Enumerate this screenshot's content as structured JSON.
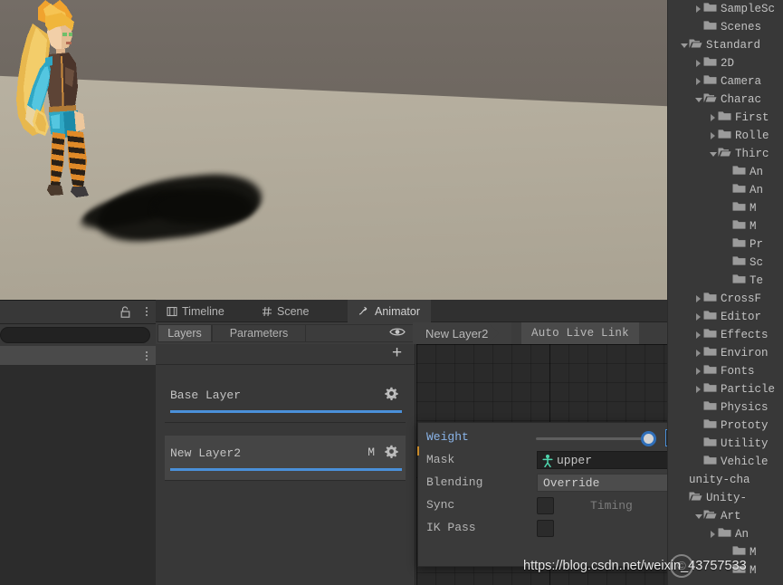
{
  "scene_view": {
    "name": "scene-viewport",
    "character_label": "character-model",
    "colors": {
      "wall": "#6d6660",
      "ground": "#aaa393",
      "shadow": "#0b0b08"
    }
  },
  "left_panel": {
    "lock_icon": "lock-icon",
    "menu_icon": "kebab-menu-icon",
    "search_placeholder": ""
  },
  "animator": {
    "tabs": [
      {
        "label": "Timeline",
        "icon": "timeline-icon",
        "active": false
      },
      {
        "label": "Scene",
        "icon": "grid-icon",
        "active": false
      },
      {
        "label": "Animator",
        "icon": "animator-icon",
        "active": true
      }
    ],
    "lock_icon": "lock-icon",
    "menu_icon": "kebab-menu-icon",
    "toolbar": {
      "layers_tab": "Layers",
      "parameters_tab": "Parameters",
      "eye_icon": "eye-icon",
      "breadcrumb": "New Layer2",
      "auto_live_link": "Auto Live Link"
    },
    "add_layer_icon": "plus-icon",
    "layers": [
      {
        "name": "Base Layer",
        "mask_flag": "",
        "gear_icon": "gear-icon",
        "selected": false
      },
      {
        "name": "New Layer2",
        "mask_flag": "M",
        "gear_icon": "gear-icon",
        "selected": true
      }
    ]
  },
  "layer_settings": {
    "weight": {
      "label": "Weight",
      "value": "1",
      "slider_min": 0,
      "slider_max": 1,
      "slider_pos": 1
    },
    "mask": {
      "label": "Mask",
      "value": "upper",
      "icon": "avatar-mask-icon",
      "picker_icon": "object-picker-icon"
    },
    "blending": {
      "label": "Blending",
      "value": "Override",
      "caret_icon": "chevron-down-icon"
    },
    "sync": {
      "label": "Sync",
      "checked": false,
      "timing_label": "Timing",
      "timing_checked": false
    },
    "ik_pass": {
      "label": "IK Pass",
      "checked": false
    }
  },
  "project_tree": [
    {
      "label": "SampleSc",
      "indent": 1,
      "twisty": "right",
      "folder": "closed"
    },
    {
      "label": "Scenes",
      "indent": 1,
      "twisty": "none",
      "folder": "closed"
    },
    {
      "label": "Standard",
      "indent": 0,
      "twisty": "down",
      "folder": "open"
    },
    {
      "label": "2D",
      "indent": 1,
      "twisty": "right",
      "folder": "closed"
    },
    {
      "label": "Camera",
      "indent": 1,
      "twisty": "right",
      "folder": "closed"
    },
    {
      "label": "Charac",
      "indent": 1,
      "twisty": "down",
      "folder": "open"
    },
    {
      "label": "First",
      "indent": 2,
      "twisty": "right",
      "folder": "closed"
    },
    {
      "label": "Rolle",
      "indent": 2,
      "twisty": "right",
      "folder": "closed"
    },
    {
      "label": "Thirc",
      "indent": 2,
      "twisty": "down",
      "folder": "open"
    },
    {
      "label": "An",
      "indent": 3,
      "twisty": "none",
      "folder": "closed"
    },
    {
      "label": "An",
      "indent": 3,
      "twisty": "none",
      "folder": "closed"
    },
    {
      "label": "M",
      "indent": 3,
      "twisty": "none",
      "folder": "closed"
    },
    {
      "label": "M",
      "indent": 3,
      "twisty": "none",
      "folder": "closed"
    },
    {
      "label": "Pr",
      "indent": 3,
      "twisty": "none",
      "folder": "closed"
    },
    {
      "label": "Sc",
      "indent": 3,
      "twisty": "none",
      "folder": "closed"
    },
    {
      "label": "Te",
      "indent": 3,
      "twisty": "none",
      "folder": "closed"
    },
    {
      "label": "CrossF",
      "indent": 1,
      "twisty": "right",
      "folder": "closed"
    },
    {
      "label": "Editor",
      "indent": 1,
      "twisty": "right",
      "folder": "closed"
    },
    {
      "label": "Effects",
      "indent": 1,
      "twisty": "right",
      "folder": "closed"
    },
    {
      "label": "Environ",
      "indent": 1,
      "twisty": "right",
      "folder": "closed"
    },
    {
      "label": "Fonts",
      "indent": 1,
      "twisty": "right",
      "folder": "closed"
    },
    {
      "label": "Particle",
      "indent": 1,
      "twisty": "right",
      "folder": "closed"
    },
    {
      "label": "Physics",
      "indent": 1,
      "twisty": "none",
      "folder": "closed"
    },
    {
      "label": "Prototy",
      "indent": 1,
      "twisty": "none",
      "folder": "closed"
    },
    {
      "label": "Utility",
      "indent": 1,
      "twisty": "none",
      "folder": "closed"
    },
    {
      "label": "Vehicle",
      "indent": 1,
      "twisty": "none",
      "folder": "closed"
    },
    {
      "label": "unity-cha",
      "indent": 0,
      "twisty": "none",
      "folder": "none"
    },
    {
      "label": "Unity-",
      "indent": 0,
      "twisty": "none",
      "folder": "open"
    },
    {
      "label": "Art",
      "indent": 1,
      "twisty": "down",
      "folder": "open"
    },
    {
      "label": "An",
      "indent": 2,
      "twisty": "right",
      "folder": "closed"
    },
    {
      "label": "M",
      "indent": 3,
      "twisty": "none",
      "folder": "closed"
    },
    {
      "label": "M",
      "indent": 3,
      "twisty": "none",
      "folder": "closed"
    }
  ],
  "watermark": {
    "text": "https://blog.csdn.net/weixin_43757533",
    "logo": "©"
  }
}
